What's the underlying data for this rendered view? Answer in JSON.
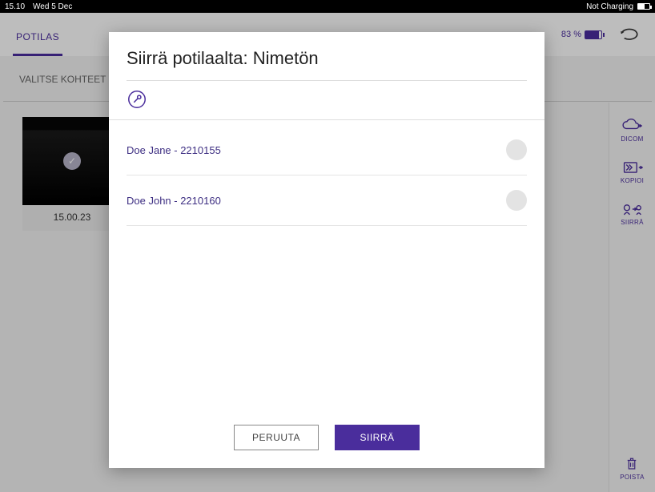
{
  "status": {
    "time": "15.10",
    "date": "Wed 5 Dec",
    "charging_label": "Not Charging"
  },
  "appbar": {
    "battery_percent": "83 %"
  },
  "tabs": {
    "patient_tab": "POTILAS"
  },
  "subheader": {
    "select_targets": "VALITSE KOHTEET"
  },
  "thumbnail": {
    "time": "15.00.23"
  },
  "sidebar": {
    "dicom": "DICOM",
    "copy": "KOPIOI",
    "move": "SIIRRÄ",
    "delete": "POISTA"
  },
  "modal": {
    "title": "Siirrä potilaalta: Nimetön",
    "patients": [
      {
        "label": "Doe Jane - 2210155"
      },
      {
        "label": "Doe John - 2210160"
      }
    ],
    "cancel": "PERUUTA",
    "confirm": "SIIRRÄ"
  }
}
